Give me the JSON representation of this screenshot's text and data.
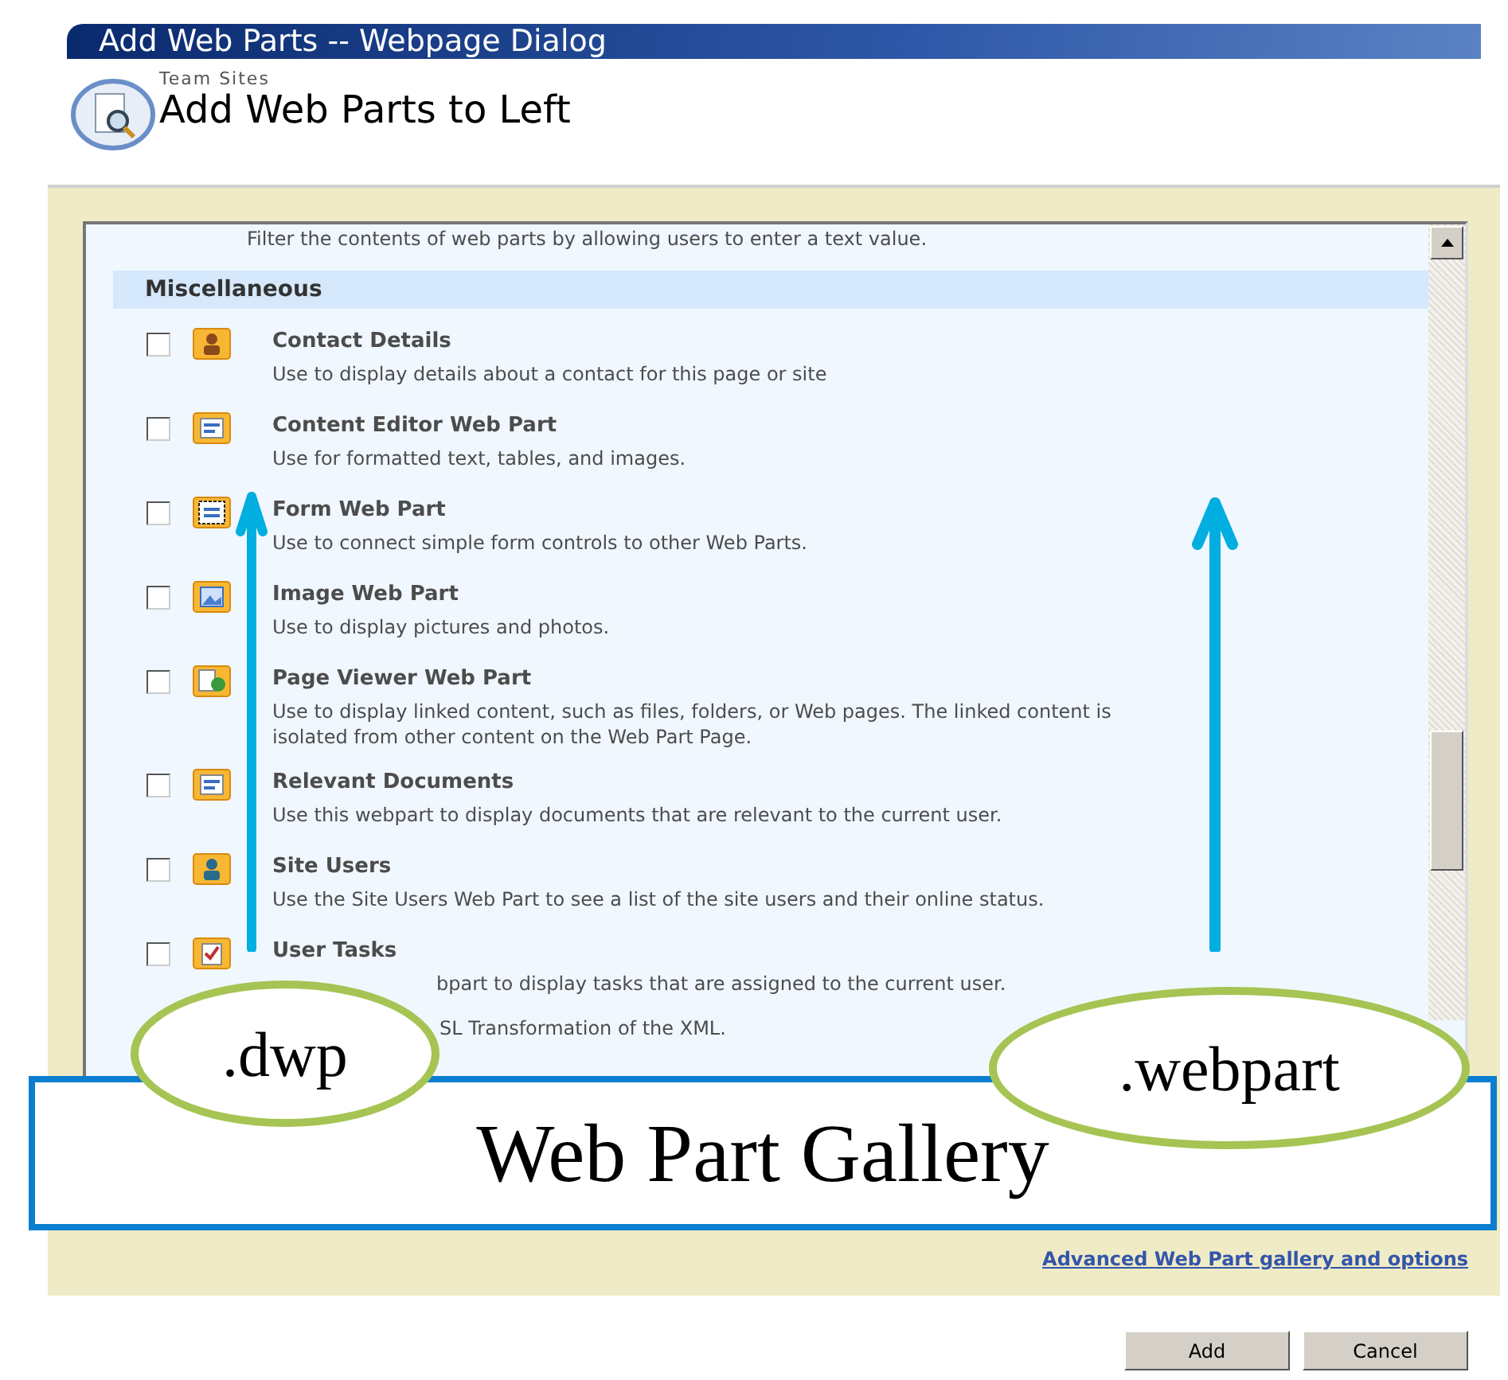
{
  "window": {
    "title": "Add Web Parts -- Webpage Dialog"
  },
  "header": {
    "breadcrumb": "Team Sites",
    "title": "Add Web Parts to Left"
  },
  "list": {
    "leading_description": "Filter the contents of web parts by allowing users to enter a text value.",
    "category": "Miscellaneous",
    "items": [
      {
        "kind": "contact",
        "title": "Contact Details",
        "description": "Use to display details about a contact for this page or site",
        "checked": false
      },
      {
        "kind": "editor",
        "title": "Content Editor Web Part",
        "description": "Use for formatted text, tables, and images.",
        "checked": false
      },
      {
        "kind": "form",
        "title": "Form Web Part",
        "description": "Use to connect simple form controls to other Web Parts.",
        "checked": false
      },
      {
        "kind": "image",
        "title": "Image Web Part",
        "description": "Use to display pictures and photos.",
        "checked": false
      },
      {
        "kind": "viewer",
        "title": "Page Viewer Web Part",
        "description": "Use to display linked content, such as files, folders, or Web pages. The linked content is isolated from other content on the Web Part Page.",
        "checked": false
      },
      {
        "kind": "documents",
        "title": "Relevant Documents",
        "description": "Use this webpart to display documents that are relevant to the current user.",
        "checked": false
      },
      {
        "kind": "users",
        "title": "Site Users",
        "description": "Use the Site Users Web Part to see a list of the site users and their online status.",
        "checked": false
      },
      {
        "kind": "tasks",
        "title": "User Tasks",
        "description": "bpart to display tasks that are assigned to the current user.",
        "checked": false
      }
    ],
    "trailing_fragment": "SL Transformation of the XML."
  },
  "link": "Advanced Web Part gallery and options",
  "buttons": [
    "Add",
    "Cancel"
  ],
  "callouts": {
    "left": ".dwp",
    "right": ".webpart",
    "banner": "Web Part Gallery"
  }
}
